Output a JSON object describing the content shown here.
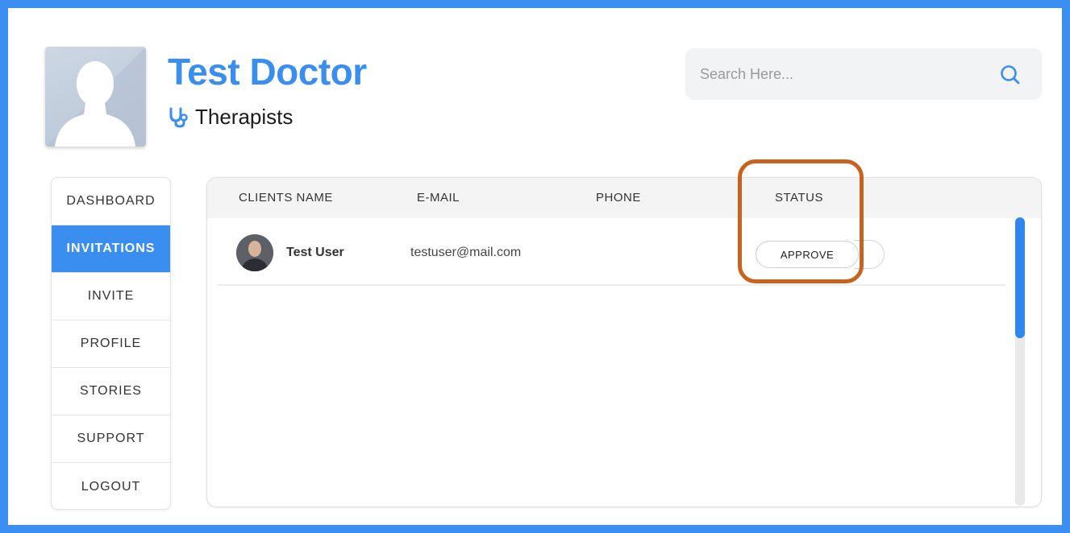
{
  "profile": {
    "name": "Test Doctor",
    "role": "Therapists"
  },
  "search": {
    "placeholder": "Search Here..."
  },
  "sidebar": {
    "items": [
      {
        "label": "DASHBOARD",
        "active": false
      },
      {
        "label": "INVITATIONS",
        "active": true
      },
      {
        "label": "INVITE",
        "active": false
      },
      {
        "label": "PROFILE",
        "active": false
      },
      {
        "label": "STORIES",
        "active": false
      },
      {
        "label": "SUPPORT",
        "active": false
      },
      {
        "label": "LOGOUT",
        "active": false
      }
    ]
  },
  "table": {
    "headers": [
      "CLIENTS NAME",
      "E-MAIL",
      "PHONE",
      "STATUS"
    ],
    "rows": [
      {
        "name": "Test User",
        "email": "testuser@mail.com",
        "phone": "",
        "action": "APPROVE"
      }
    ]
  },
  "colors": {
    "accent": "#3a8ef0",
    "frame": "#3c8ff2",
    "highlight": "#c8621f"
  },
  "icons": {
    "role": "stethoscope-icon",
    "search": "search-icon"
  }
}
